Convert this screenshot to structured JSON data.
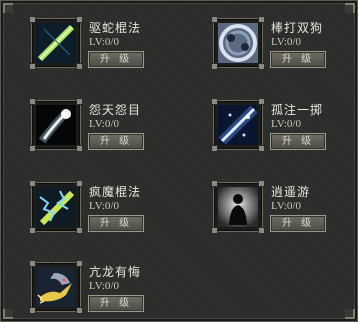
{
  "skills": [
    {
      "name": "驱蛇棍法",
      "level": "LV:0/0",
      "upgrade_label": "升 级",
      "icon": "green-staff-icon"
    },
    {
      "name": "棒打双狗",
      "level": "LV:0/0",
      "upgrade_label": "升 级",
      "icon": "twin-dogs-swirl-icon"
    },
    {
      "name": "怨天怨目",
      "level": "LV:0/0",
      "upgrade_label": "升 级",
      "icon": "white-comet-icon"
    },
    {
      "name": "孤注一掷",
      "level": "LV:0/0",
      "upgrade_label": "升 级",
      "icon": "light-beam-icon"
    },
    {
      "name": "疯魔棍法",
      "level": "LV:0/0",
      "upgrade_label": "升 级",
      "icon": "lightning-staff-icon"
    },
    {
      "name": "逍遥游",
      "level": "LV:0/0",
      "upgrade_label": "升 级",
      "icon": "shadow-figure-icon"
    },
    {
      "name": "亢龙有悔",
      "level": "LV:0/0",
      "upgrade_label": "升 级",
      "icon": "dragon-icon"
    }
  ],
  "colors": {
    "panel_bg": "#2c2c2a",
    "text": "#e6e6de",
    "button": "#5e5e55"
  }
}
